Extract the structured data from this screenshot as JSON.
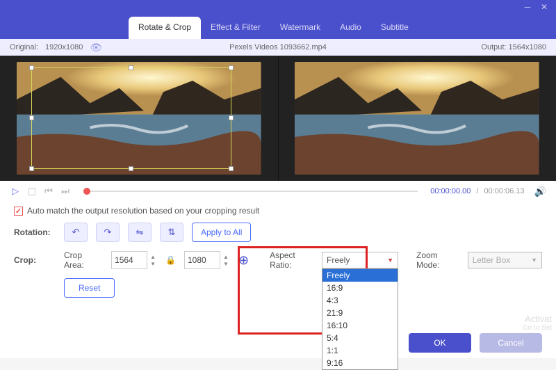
{
  "window": {
    "minimize": "─",
    "close": "✕"
  },
  "tabs": [
    "Rotate & Crop",
    "Effect & Filter",
    "Watermark",
    "Audio",
    "Subtitle"
  ],
  "active_tab_index": 0,
  "infobar": {
    "original_label": "Original:",
    "original_value": "1920x1080",
    "filename": "Pexels Videos 1093662.mp4",
    "output_label": "Output:",
    "output_value": "1564x1080"
  },
  "playbar": {
    "current": "00:00:00.00",
    "sep": "/",
    "total": "00:00:06.13"
  },
  "automatch": {
    "checked": true,
    "label": "Auto match the output resolution based on your cropping result"
  },
  "rotation": {
    "label": "Rotation:",
    "apply_all": "Apply to All",
    "buttons": [
      "rotate-ccw",
      "rotate-cw",
      "flip-h",
      "flip-v"
    ]
  },
  "crop": {
    "label": "Crop:",
    "area_label": "Crop Area:",
    "width": "1564",
    "height": "1080",
    "reset": "Reset"
  },
  "aspect": {
    "label": "Aspect Ratio:",
    "selected": "Freely",
    "options": [
      "Freely",
      "16:9",
      "4:3",
      "21:9",
      "16:10",
      "5:4",
      "1:1",
      "9:16"
    ]
  },
  "zoom": {
    "label": "Zoom Mode:",
    "selected": "Letter Box"
  },
  "footer": {
    "ok": "OK",
    "cancel": "Cancel"
  },
  "watermark": {
    "l1": "Activat",
    "l2": "Go to Set"
  },
  "colors": {
    "primary": "#4a4fcc",
    "accent": "#e55",
    "red_frame": "#d22"
  }
}
